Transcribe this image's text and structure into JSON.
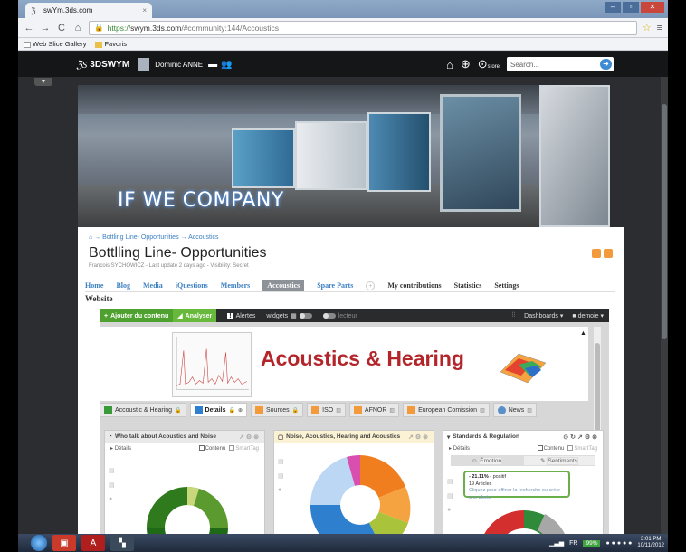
{
  "browser": {
    "tab_title": "swYm.3ds.com",
    "url_scheme": "https://",
    "url_host": "swym.3ds.com",
    "url_path": "/#community:144/Accoustics",
    "bookmarks": [
      "Web Slice Gallery",
      "Favoris"
    ]
  },
  "swym": {
    "brand": "3DSWYM",
    "user": "Dominic ANNE",
    "search_placeholder": "Search...",
    "store_label": "store"
  },
  "banner": {
    "title": "IF WE COMPANY"
  },
  "community": {
    "breadcrumb": [
      "Bottling Line- Opportunities",
      "Accoustics"
    ],
    "title": "Bottlling Line- Opportunities",
    "meta": "Francois SYCHOWICZ - Last update 2 days ago - Visibility: Secret",
    "tabs": [
      "Home",
      "Blog",
      "Media",
      "iQuestions",
      "Members",
      "Accoustics",
      "Spare Parts"
    ],
    "active_tab": "Accoustics",
    "right_tabs": [
      "My contributions",
      "Statistics",
      "Settings"
    ],
    "section": "Website"
  },
  "widget_toolbar": {
    "add_label": "Ajouter du contenu",
    "analyze_label": "Analyser",
    "alerts_label": "Alertes",
    "widgets_label": "widgets",
    "reader_label": "lecteur",
    "dashboards_label": "Dashboards",
    "demo_label": "demoie"
  },
  "acoustics_banner": {
    "title": "Acoustics & Hearing"
  },
  "sub_tabs": [
    {
      "label": "Accoustic & Hearing",
      "color": "#3a9a3a"
    },
    {
      "label": "Details",
      "color": "#2f7fcf",
      "active": true
    },
    {
      "label": "Sources",
      "color": "#f29a3c"
    },
    {
      "label": "ISO",
      "color": "#f29a3c"
    },
    {
      "label": "AFNOR",
      "color": "#f29a3c"
    },
    {
      "label": "European Comission",
      "color": "#f29a3c"
    },
    {
      "label": "News",
      "color": "#5a8fc9"
    }
  ],
  "widgets": {
    "w1": {
      "title": "Who talk about Acoustics and Noise",
      "details": "Détails",
      "contenu": "Contenu",
      "smarttag": "SmartTag"
    },
    "w2": {
      "title": "Noise, Acoustics, Hearing and Acoustics"
    },
    "w3": {
      "title": "Standards & Regulation",
      "details": "Détails",
      "contenu": "Contenu",
      "smarttag": "SmartTag",
      "emotion": "Émotion",
      "sentiments": "Sentiments",
      "tooltip_value": "- 21.11% -",
      "tooltip_label": "positif",
      "tooltip_count": "19 Articles",
      "tooltip_hint": "Cliquez pour affiner la recherche ou créer une alerte"
    }
  },
  "taskbar": {
    "lang": "FR",
    "battery": "99%",
    "time": "3:01 PM",
    "date": "10/11/2012"
  }
}
